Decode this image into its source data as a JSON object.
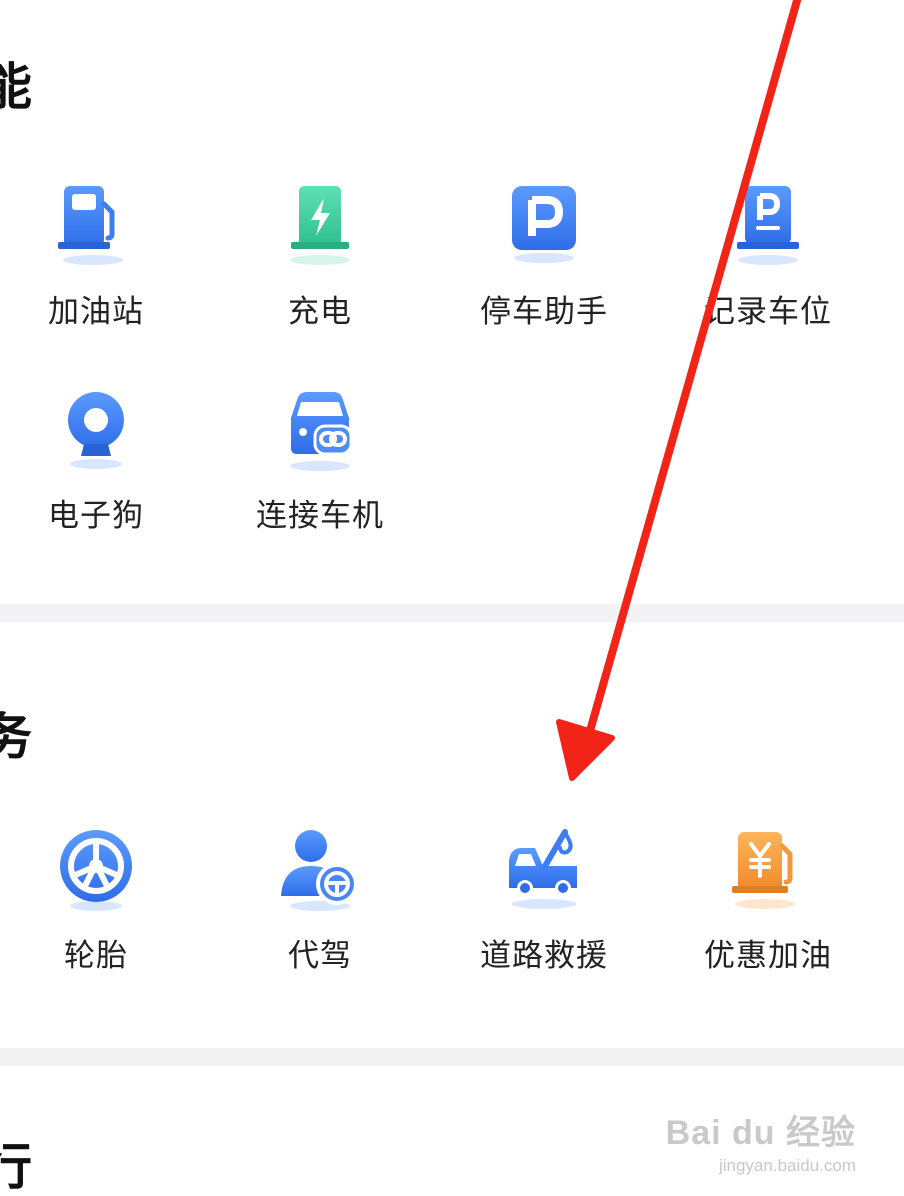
{
  "section1": {
    "title": "能",
    "items": [
      {
        "label": "加油站",
        "icon": "gas-station-icon"
      },
      {
        "label": "充电",
        "icon": "charging-icon"
      },
      {
        "label": "停车助手",
        "icon": "parking-assistant-icon"
      },
      {
        "label": "记录车位",
        "icon": "record-parking-icon"
      },
      {
        "label": "电子狗",
        "icon": "speed-camera-icon"
      },
      {
        "label": "连接车机",
        "icon": "connect-car-icon"
      }
    ]
  },
  "section2": {
    "title": "务",
    "items": [
      {
        "label": "轮胎",
        "icon": "tire-icon"
      },
      {
        "label": "代驾",
        "icon": "designated-driver-icon"
      },
      {
        "label": "道路救援",
        "icon": "road-rescue-icon"
      },
      {
        "label": "优惠加油",
        "icon": "discount-fuel-icon"
      }
    ]
  },
  "section3": {
    "title": "行"
  },
  "watermark": {
    "main": "Bai du 经验",
    "sub": "jingyan.baidu.com"
  },
  "colors": {
    "primary_blue": "#3d7cf2",
    "charge_green": "#3fcf9f",
    "fuel_orange": "#f29a3a",
    "annotation_red": "#f22418",
    "divider": "#f3f3f5"
  }
}
